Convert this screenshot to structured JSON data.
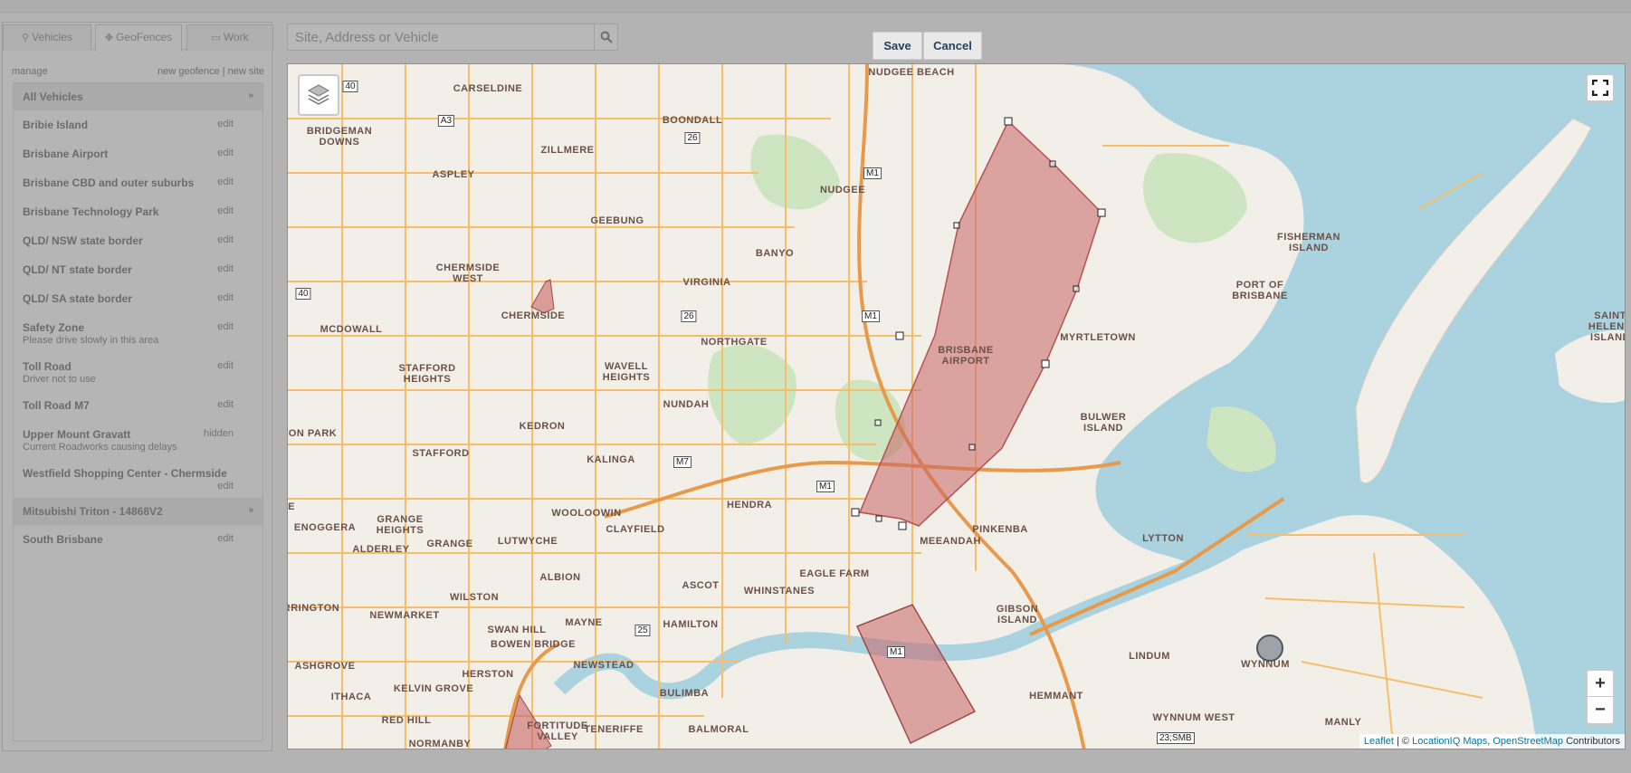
{
  "tabs": [
    {
      "label": "Vehicles",
      "icon": "map-marker-icon"
    },
    {
      "label": "GeoFences",
      "icon": "move-icon"
    },
    {
      "label": "Work",
      "icon": "monitor-icon"
    }
  ],
  "manage": {
    "label": "manage",
    "new_geofence": "new geofence",
    "separator": "|",
    "new_site": "new site"
  },
  "groups": [
    {
      "title": "All Vehicles",
      "chevron": "»"
    },
    {
      "title": "Mitsubishi Triton - 14868V2",
      "chevron": "»"
    }
  ],
  "items": [
    {
      "name": "Bribie Island",
      "action": "edit"
    },
    {
      "name": "Brisbane Airport",
      "action": "edit"
    },
    {
      "name": "Brisbane CBD and outer suburbs",
      "action": "edit"
    },
    {
      "name": "Brisbane Technology Park",
      "action": "edit"
    },
    {
      "name": "QLD/ NSW state border",
      "action": "edit"
    },
    {
      "name": "QLD/ NT state border",
      "action": "edit"
    },
    {
      "name": "QLD/ SA state border",
      "action": "edit"
    },
    {
      "name": "Safety Zone",
      "sub": "Please drive slowly in this area",
      "action": "edit"
    },
    {
      "name": "Toll Road",
      "sub": "Driver not to use",
      "action": "edit"
    },
    {
      "name": "Toll Road M7",
      "action": "edit"
    },
    {
      "name": "Upper Mount Gravatt",
      "sub": "Current Roadworks causing delays",
      "action": "hidden"
    },
    {
      "name": "Westfield Shopping Center - Chermside",
      "action": "edit"
    },
    {
      "name": "South Brisbane",
      "action": "edit"
    }
  ],
  "search": {
    "placeholder": "Site, Address or Vehicle"
  },
  "actions": {
    "save": "Save",
    "cancel": "Cancel"
  },
  "map": {
    "labels": [
      "NUDGEE BEACH",
      "CARSELDINE",
      "BRIDGEMAN DOWNS",
      "BOONDALL",
      "ZILLMERE",
      "ASPLEY",
      "NUDGEE",
      "GEEBUNG",
      "BANYO",
      "CHERMSIDE WEST",
      "CHERMSIDE",
      "VIRGINIA",
      "MCDOWALL",
      "NORTHGATE",
      "STAFFORD HEIGHTS",
      "WAVELL HEIGHTS",
      "NUNDAH",
      "KEDRON",
      "STAFFORD",
      "KALINGA",
      "TON PARK",
      "GRANGE HEIGHTS",
      "ENOGGERA",
      "ALDERLEY",
      "GRANGE",
      "LUTWYCHE",
      "WOOLOOWIN",
      "CLAYFIELD",
      "HENDRA",
      "ALBION",
      "ASCOT",
      "WHINSTANES",
      "EAGLE FARM",
      "WILSTON",
      "NEWMARKET",
      "RRINGTON",
      "SWAN HILL",
      "BOWEN BRIDGE",
      "MAYNE",
      "HAMILTON",
      "ASHGROVE",
      "HERSTON",
      "NEWSTEAD",
      "BULIMBA",
      "ITHACA",
      "KELVIN GROVE",
      "RED HILL",
      "FORTITUDE VALLEY",
      "TENERIFFE",
      "BALMORAL",
      "NORMANBY",
      "BRISBANE AIRPORT",
      "MYRTLETOWN",
      "BULWER ISLAND",
      "PINKENBA",
      "MEEANDAH",
      "LYTTON",
      "GIBSON ISLAND",
      "LINDUM",
      "HEMMANT",
      "WYNNUM WEST",
      "WYNNUM",
      "MANLY",
      "FISHERMAN ISLAND",
      "PORT OF BRISBANE",
      "SAINT HELENA ISLAND",
      "E"
    ],
    "shields": [
      "40",
      "A3",
      "26",
      "M1",
      "40",
      "26",
      "M1",
      "M7",
      "M1",
      "25",
      "M1"
    ],
    "scale_label": "23;SMB",
    "zoom_in": "+",
    "zoom_out": "−",
    "attribution": {
      "leaflet": "Leaflet",
      "sep": " | © ",
      "liq": "LocationIQ Maps",
      "comma": ", ",
      "osm": "OpenStreetMap",
      "contrib": " Contributors"
    },
    "colors": {
      "land": "#f2efe9",
      "water": "#aad3df",
      "geofence": "#c86464",
      "road": "#f7be6a"
    }
  }
}
